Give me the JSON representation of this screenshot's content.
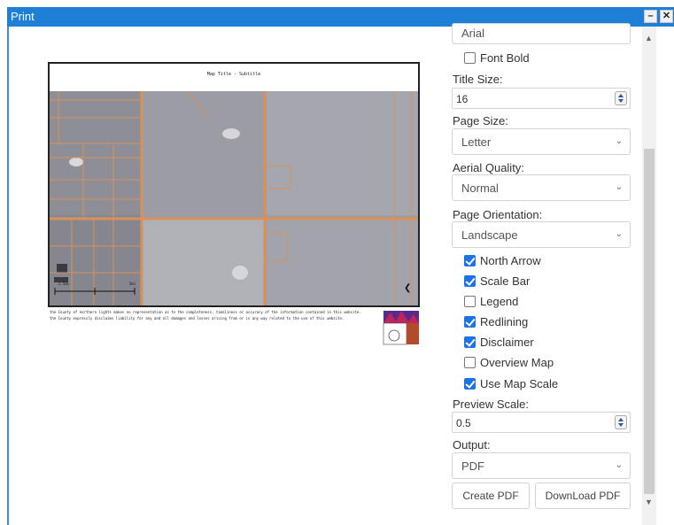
{
  "window": {
    "title": "Print"
  },
  "map": {
    "title": "Map Title - Subtitle",
    "disclaimer": "the County of northern lights makes no representation as to the completeness, timeliness or accuracy of the information contained in this website. the County expressly disclaims liability for any and all damages and losses arising from or in any way related to the use of this website.",
    "scale_labels": [
      "2.5mi",
      "5mi"
    ]
  },
  "panel": {
    "font": {
      "value": "Arial"
    },
    "font_bold": {
      "label": "Font Bold",
      "checked": false
    },
    "title_size": {
      "label": "Title Size:",
      "value": "16"
    },
    "page_size": {
      "label": "Page Size:",
      "value": "Letter"
    },
    "aerial_quality": {
      "label": "Aerial Quality:",
      "value": "Normal"
    },
    "page_orientation": {
      "label": "Page Orientation:",
      "value": "Landscape"
    },
    "options": [
      {
        "label": "North Arrow",
        "checked": true
      },
      {
        "label": "Scale Bar",
        "checked": true
      },
      {
        "label": "Legend",
        "checked": false
      },
      {
        "label": "Redlining",
        "checked": true
      },
      {
        "label": "Disclaimer",
        "checked": true
      },
      {
        "label": "Overview Map",
        "checked": false
      },
      {
        "label": "Use Map Scale",
        "checked": true
      }
    ],
    "preview_scale": {
      "label": "Preview Scale:",
      "value": "0.5"
    },
    "output": {
      "label": "Output:",
      "value": "PDF"
    },
    "create_button": "Create PDF",
    "download_button": "DownLoad PDF"
  },
  "colors": {
    "titlebar": "#1e7fd6",
    "checkbox": "#1a73e8",
    "parcel_lines": "#d9915a"
  }
}
